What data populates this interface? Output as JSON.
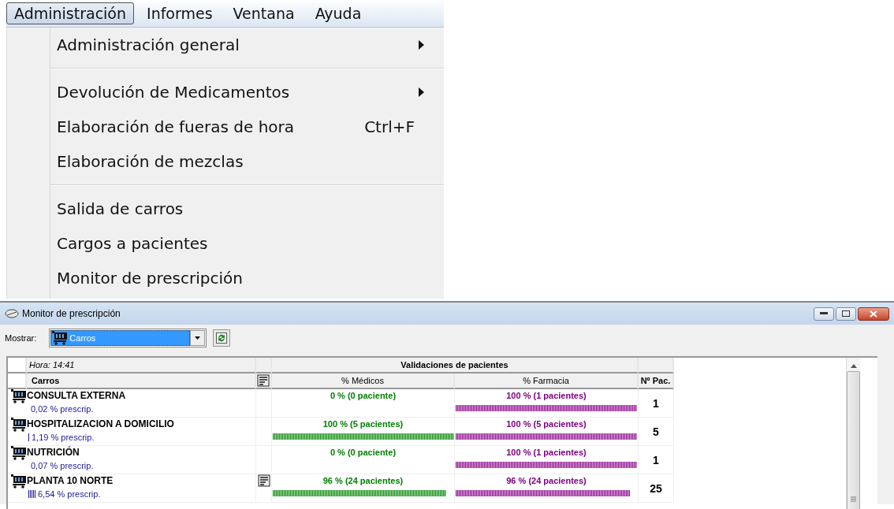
{
  "menu_bar": [
    {
      "label": "Administración",
      "selected": true
    },
    {
      "label": "Informes",
      "selected": false
    },
    {
      "label": "Ventana",
      "selected": false
    },
    {
      "label": "Ayuda",
      "selected": false
    }
  ],
  "dropdown": [
    {
      "kind": "item",
      "label": "Administración general",
      "submenu": true
    },
    {
      "kind": "separator"
    },
    {
      "kind": "item",
      "label": "Devolución de Medicamentos",
      "submenu": true
    },
    {
      "kind": "item",
      "label": "Elaboración de fueras de hora",
      "submenu": false,
      "shortcut": "Ctrl+F"
    },
    {
      "kind": "item",
      "label": "Elaboración de mezclas",
      "submenu": false
    },
    {
      "kind": "separator"
    },
    {
      "kind": "item",
      "label": "Salida de carros",
      "submenu": false
    },
    {
      "kind": "item",
      "label": "Cargos a pacientes",
      "submenu": false
    },
    {
      "kind": "item",
      "label": "Monitor de prescripción",
      "submenu": false
    }
  ],
  "window": {
    "title": "Monitor de prescripción",
    "filter": {
      "label": "Mostrar:",
      "value": "Carros"
    },
    "table": {
      "time": "Hora: 14:41",
      "group_header": "Validaciones de pacientes",
      "columns": [
        "Carros",
        "% Médicos",
        "% Farmacia",
        "Nº Pac."
      ],
      "rows": [
        {
          "name": "CONSULTA EXTERNA",
          "prescrip": {
            "text": "0,02 % prescrip.",
            "level": 0.0002
          },
          "note": false,
          "medicos": {
            "text": "0 %  (0 paciente)",
            "level": 0
          },
          "farmacia": {
            "text": "100 %  (1 pacientes)",
            "level": 1
          },
          "count": "1"
        },
        {
          "name": "HOSPITALIZACION A DOMICILIO",
          "prescrip": {
            "text": "1,19 % prescrip.",
            "level": 0.0119
          },
          "note": false,
          "medicos": {
            "text": "100 %  (5 pacientes)",
            "level": 1
          },
          "farmacia": {
            "text": "100 %  (5 pacientes)",
            "level": 1
          },
          "count": "5"
        },
        {
          "name": "NUTRICIÓN",
          "prescrip": {
            "text": "0,07 % prescrip.",
            "level": 0.0007
          },
          "note": false,
          "medicos": {
            "text": "0 %  (0 paciente)",
            "level": 0
          },
          "farmacia": {
            "text": "100 %  (1 pacientes)",
            "level": 1
          },
          "count": "1"
        },
        {
          "name": "PLANTA 10 NORTE",
          "prescrip": {
            "text": "6,54 % prescrip.",
            "level": 0.0654
          },
          "note": true,
          "medicos": {
            "text": "96 %  (24 pacientes)",
            "level": 0.96
          },
          "farmacia": {
            "text": "96 %  (24 pacientes)",
            "level": 0.96
          },
          "count": "25"
        }
      ]
    }
  }
}
